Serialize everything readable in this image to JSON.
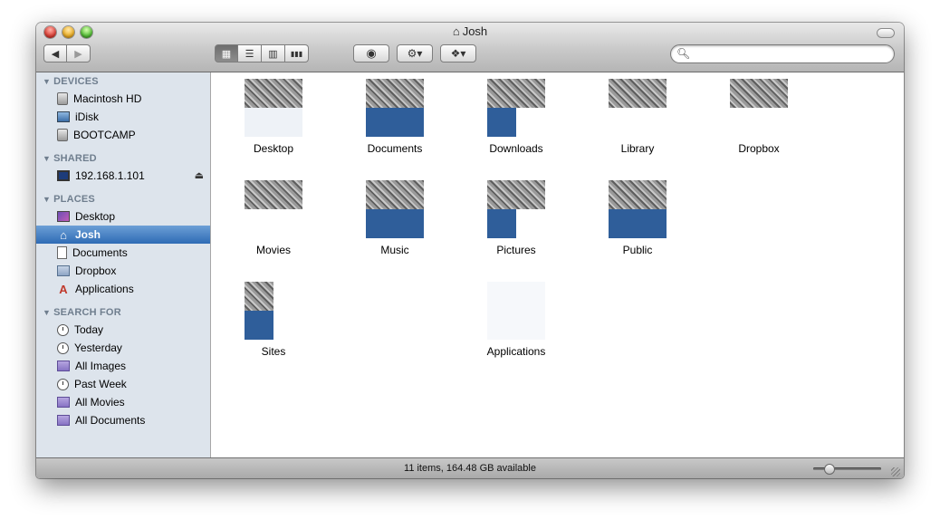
{
  "window": {
    "title": "Josh",
    "title_icon": "home-icon"
  },
  "toolbar": {
    "back_glyph": "◀",
    "forward_glyph": "▶",
    "view_modes": [
      {
        "name": "icon-view",
        "glyph": "▦",
        "active": true
      },
      {
        "name": "list-view",
        "glyph": "☰",
        "active": false
      },
      {
        "name": "column-view",
        "glyph": "▥",
        "active": false
      },
      {
        "name": "coverflow-view",
        "glyph": "▮▮▮",
        "active": false
      }
    ],
    "quicklook_glyph": "◉",
    "action_glyph": "⚙▾",
    "dropbox_glyph": "❖▾",
    "search": {
      "value": "",
      "placeholder": ""
    }
  },
  "sidebar": {
    "devices": {
      "header": "DEVICES",
      "items": [
        {
          "label": "Macintosh HD",
          "icon": "hard-drive-icon"
        },
        {
          "label": "iDisk",
          "icon": "idisk-icon"
        },
        {
          "label": "BOOTCAMP",
          "icon": "hard-drive-icon"
        }
      ]
    },
    "shared": {
      "header": "SHARED",
      "items": [
        {
          "label": "192.168.1.101",
          "icon": "monitor-icon",
          "eject": "⏏"
        }
      ]
    },
    "places": {
      "header": "PLACES",
      "items": [
        {
          "label": "Desktop",
          "icon": "desktop-icon"
        },
        {
          "label": "Josh",
          "icon": "home-icon",
          "selected": true
        },
        {
          "label": "Documents",
          "icon": "document-icon"
        },
        {
          "label": "Dropbox",
          "icon": "dropbox-icon"
        },
        {
          "label": "Applications",
          "icon": "applications-icon"
        }
      ]
    },
    "search_for": {
      "header": "SEARCH FOR",
      "items": [
        {
          "label": "Today",
          "icon": "clock-icon"
        },
        {
          "label": "Yesterday",
          "icon": "clock-icon"
        },
        {
          "label": "All Images",
          "icon": "smart-folder-icon"
        },
        {
          "label": "Past Week",
          "icon": "clock-icon"
        },
        {
          "label": "All Movies",
          "icon": "smart-folder-icon"
        },
        {
          "label": "All Documents",
          "icon": "smart-folder-icon"
        }
      ]
    }
  },
  "files": [
    {
      "label": "Desktop"
    },
    {
      "label": "Documents"
    },
    {
      "label": "Downloads"
    },
    {
      "label": "Library"
    },
    {
      "label": "Dropbox"
    },
    {
      "label": "Movies"
    },
    {
      "label": "Music"
    },
    {
      "label": "Pictures"
    },
    {
      "label": "Public"
    },
    {
      "label": "Sites"
    },
    {
      "label": "Applications"
    }
  ],
  "status": {
    "text": "11 items, 164.48 GB available"
  },
  "colors": {
    "selection": "#2e6bb5",
    "sidebar_bg": "#dde4ec",
    "section_header": "#6f7e8e"
  }
}
